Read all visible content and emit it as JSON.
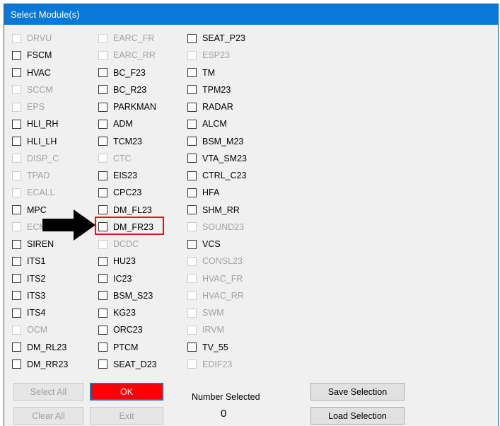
{
  "window": {
    "title": "Select Module(s)"
  },
  "columns": [
    [
      {
        "label": "DRVU",
        "enabled": false
      },
      {
        "label": "FSCM",
        "enabled": true
      },
      {
        "label": "HVAC",
        "enabled": true
      },
      {
        "label": "SCCM",
        "enabled": false
      },
      {
        "label": "EPS",
        "enabled": false
      },
      {
        "label": "HLI_RH",
        "enabled": true
      },
      {
        "label": "HLI_LH",
        "enabled": true
      },
      {
        "label": "DISP_C",
        "enabled": false
      },
      {
        "label": "TPAD",
        "enabled": false
      },
      {
        "label": "ECALL",
        "enabled": false
      },
      {
        "label": "MPC",
        "enabled": true
      },
      {
        "label": "ECM",
        "enabled": false
      },
      {
        "label": "SIREN",
        "enabled": true
      },
      {
        "label": "ITS1",
        "enabled": true
      },
      {
        "label": "ITS2",
        "enabled": true
      },
      {
        "label": "ITS3",
        "enabled": true
      },
      {
        "label": "ITS4",
        "enabled": true
      },
      {
        "label": "OCM",
        "enabled": false
      },
      {
        "label": "DM_RL23",
        "enabled": true
      },
      {
        "label": "DM_RR23",
        "enabled": true
      }
    ],
    [
      {
        "label": "EARC_FR",
        "enabled": false
      },
      {
        "label": "EARC_RR",
        "enabled": false
      },
      {
        "label": "BC_F23",
        "enabled": true
      },
      {
        "label": "BC_R23",
        "enabled": true
      },
      {
        "label": "PARKMAN",
        "enabled": true
      },
      {
        "label": "ADM",
        "enabled": true
      },
      {
        "label": "TCM23",
        "enabled": true
      },
      {
        "label": "CTC",
        "enabled": false
      },
      {
        "label": "EIS23",
        "enabled": true
      },
      {
        "label": "CPC23",
        "enabled": true
      },
      {
        "label": "DM_FL23",
        "enabled": true
      },
      {
        "label": "DM_FR23",
        "enabled": true
      },
      {
        "label": "DCDC",
        "enabled": false
      },
      {
        "label": "HU23",
        "enabled": true
      },
      {
        "label": "IC23",
        "enabled": true
      },
      {
        "label": "BSM_S23",
        "enabled": true
      },
      {
        "label": "KG23",
        "enabled": true
      },
      {
        "label": "ORC23",
        "enabled": true
      },
      {
        "label": "PTCM",
        "enabled": true
      },
      {
        "label": "SEAT_D23",
        "enabled": true
      }
    ],
    [
      {
        "label": "SEAT_P23",
        "enabled": true
      },
      {
        "label": "ESP23",
        "enabled": false
      },
      {
        "label": "TM",
        "enabled": true
      },
      {
        "label": "TPM23",
        "enabled": true
      },
      {
        "label": "RADAR",
        "enabled": true
      },
      {
        "label": "ALCM",
        "enabled": true
      },
      {
        "label": "BSM_M23",
        "enabled": true
      },
      {
        "label": "VTA_SM23",
        "enabled": true
      },
      {
        "label": "CTRL_C23",
        "enabled": true
      },
      {
        "label": "HFA",
        "enabled": true
      },
      {
        "label": "SHM_RR",
        "enabled": true
      },
      {
        "label": "SOUND23",
        "enabled": false
      },
      {
        "label": "VCS",
        "enabled": true
      },
      {
        "label": "CONSL23",
        "enabled": false
      },
      {
        "label": "HVAC_FR",
        "enabled": false
      },
      {
        "label": "HVAC_RR",
        "enabled": false
      },
      {
        "label": "SWM",
        "enabled": false
      },
      {
        "label": "IRVM",
        "enabled": false
      },
      {
        "label": "TV_55",
        "enabled": true
      },
      {
        "label": "EDIF23",
        "enabled": false
      }
    ]
  ],
  "buttons": {
    "select_all": "Select All",
    "ok": "OK",
    "clear_all": "Clear All",
    "exit": "Exit",
    "save_selection": "Save Selection",
    "load_selection": "Load Selection"
  },
  "selection": {
    "label": "Number Selected",
    "count": "0"
  },
  "colors": {
    "titlebar": "#0a78d7",
    "highlight": "#e3141b",
    "ok_button": "#ff0000"
  }
}
